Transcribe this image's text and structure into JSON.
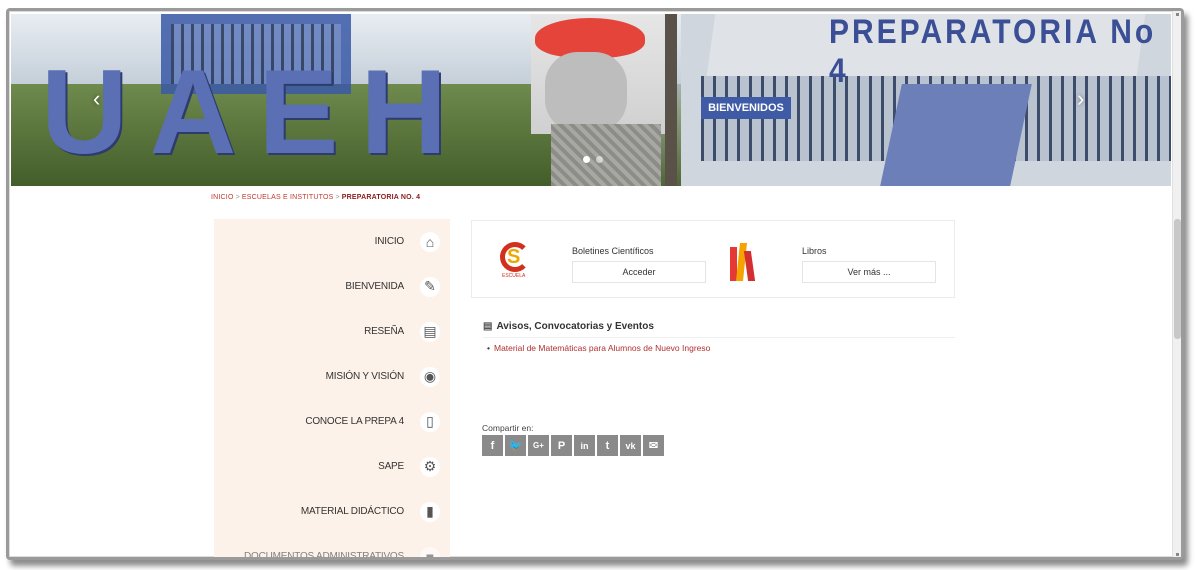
{
  "hero": {
    "campus_letters": [
      "U",
      "A",
      "E",
      "H"
    ],
    "sign_text": "PREPARATORIA No 4",
    "welcome_banner": "BIENVENIDOS",
    "prev_arrow": "‹",
    "next_arrow": "›"
  },
  "breadcrumb": {
    "items": [
      "Inicio",
      "Escuelas e Institutos",
      "Preparatoria No. 4"
    ],
    "separator": ">"
  },
  "sidebar": {
    "items": [
      {
        "label": "INICIO",
        "icon": "home-icon",
        "glyph": "⌂"
      },
      {
        "label": "BIENVENIDA",
        "icon": "edit-icon",
        "glyph": "✎"
      },
      {
        "label": "RESEÑA",
        "icon": "document-icon",
        "glyph": "▤"
      },
      {
        "label": "MISIÓN Y VISIÓN",
        "icon": "eye-icon",
        "glyph": "◉"
      },
      {
        "label": "CONOCE LA PREPA 4",
        "icon": "tablet-icon",
        "glyph": "▯"
      },
      {
        "label": "SAPE",
        "icon": "gears-icon",
        "glyph": "⚙"
      },
      {
        "label": "MATERIAL DIDÁCTICO",
        "icon": "book-icon",
        "glyph": "▮"
      },
      {
        "label": "DOCUMENTOS ADMINISTRATIVOS",
        "icon": "folder-icon",
        "glyph": "■"
      }
    ]
  },
  "cards": {
    "boletines": {
      "title": "Boletines Científicos",
      "button": "Acceder",
      "logo_text": "ESCUELA"
    },
    "libros": {
      "title": "Libros",
      "button": "Ver más ..."
    }
  },
  "avisos": {
    "title": "Avisos, Convocatorias y Eventos",
    "items": [
      "Material de Matemáticas para Alumnos de Nuevo Ingreso"
    ]
  },
  "share": {
    "label": "Compartir en:",
    "buttons": [
      {
        "name": "facebook-icon",
        "glyph": "f"
      },
      {
        "name": "twitter-icon",
        "glyph": "🐦"
      },
      {
        "name": "google-plus-icon",
        "glyph": "G+"
      },
      {
        "name": "pinterest-icon",
        "glyph": "P"
      },
      {
        "name": "linkedin-icon",
        "glyph": "in"
      },
      {
        "name": "tumblr-icon",
        "glyph": "t"
      },
      {
        "name": "vk-icon",
        "glyph": "vk"
      },
      {
        "name": "email-icon",
        "glyph": "✉"
      }
    ]
  },
  "colors": {
    "accent_red": "#c0392b",
    "sidebar_bg": "#fdf2e9",
    "share_gray": "#8a8a8a"
  }
}
